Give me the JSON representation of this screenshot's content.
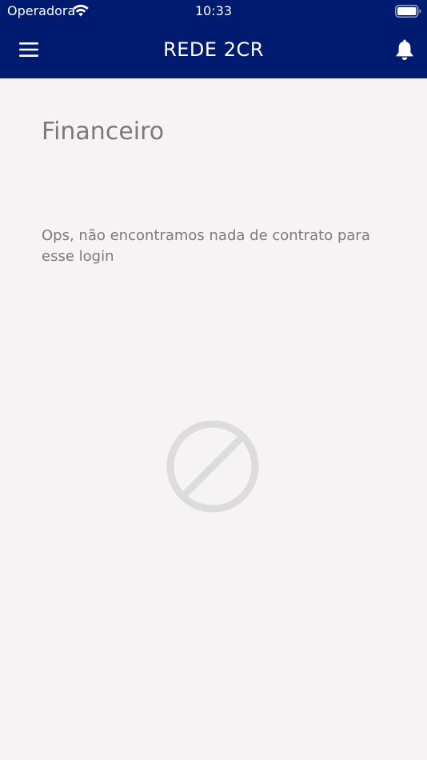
{
  "status_bar": {
    "carrier": "Operadora",
    "time": "10:33"
  },
  "header": {
    "title": "REDE 2CR",
    "menu_icon": "hamburger-menu-icon",
    "notification_icon": "bell-icon",
    "background_color": "#001b70"
  },
  "main": {
    "page_title": "Financeiro",
    "empty_message": "Ops, não encontramos nada de contrato para esse login",
    "empty_icon": "prohibited-icon"
  }
}
